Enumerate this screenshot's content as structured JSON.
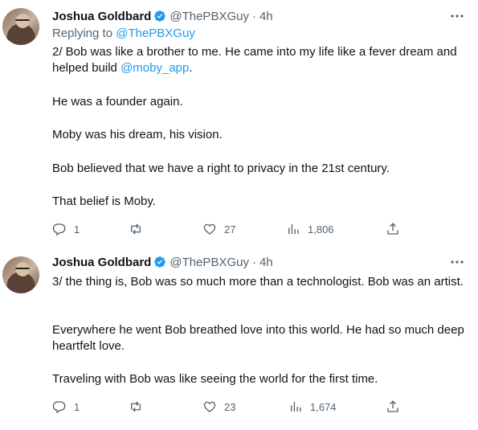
{
  "tweets": [
    {
      "author": {
        "name": "Joshua Goldbard",
        "handle": "@ThePBXGuy",
        "time": "4h"
      },
      "separator": "·",
      "replying": {
        "label": "Replying to",
        "handle": "@ThePBXGuy"
      },
      "paragraphs": [
        {
          "text": "2/ Bob was like a brother to me. He came into my life like a fever dream and helped build ",
          "mention": "@moby_app",
          "tail": "."
        },
        {
          "text": "He was a founder again.",
          "mention": "",
          "tail": ""
        },
        {
          "text": "Moby was his dream, his vision.",
          "mention": "",
          "tail": ""
        },
        {
          "text": "Bob believed that we have a right to privacy in the 21st century.",
          "mention": "",
          "tail": ""
        },
        {
          "text": "That belief is Moby.",
          "mention": "",
          "tail": ""
        }
      ],
      "stats": {
        "replies": "1",
        "retweets": "",
        "likes": "27",
        "views": "1,806"
      }
    },
    {
      "author": {
        "name": "Joshua Goldbard",
        "handle": "@ThePBXGuy",
        "time": "4h"
      },
      "separator": "·",
      "paragraphs": [
        {
          "text": "3/ the thing is, Bob was so much more than a technologist. Bob was an artist.",
          "mention": "",
          "tail": ""
        },
        {
          "text": "Everywhere he went Bob breathed love into this world. He had so much deep heartfelt love.",
          "mention": "",
          "tail": ""
        },
        {
          "text": "Traveling with Bob was like seeing the world for the first time.",
          "mention": "",
          "tail": ""
        }
      ],
      "stats": {
        "replies": "1",
        "retweets": "",
        "likes": "23",
        "views": "1,674"
      }
    }
  ],
  "icons": {
    "verified": "verified-badge-icon",
    "more": "more-dots-icon",
    "reply": "reply-icon",
    "retweet": "retweet-icon",
    "like": "heart-icon",
    "views": "views-bar-chart-icon",
    "share": "share-icon"
  },
  "colors": {
    "link": "#1d9bf0",
    "muted": "#536471",
    "text": "#0f1419",
    "verified": "#1d9bf0"
  }
}
